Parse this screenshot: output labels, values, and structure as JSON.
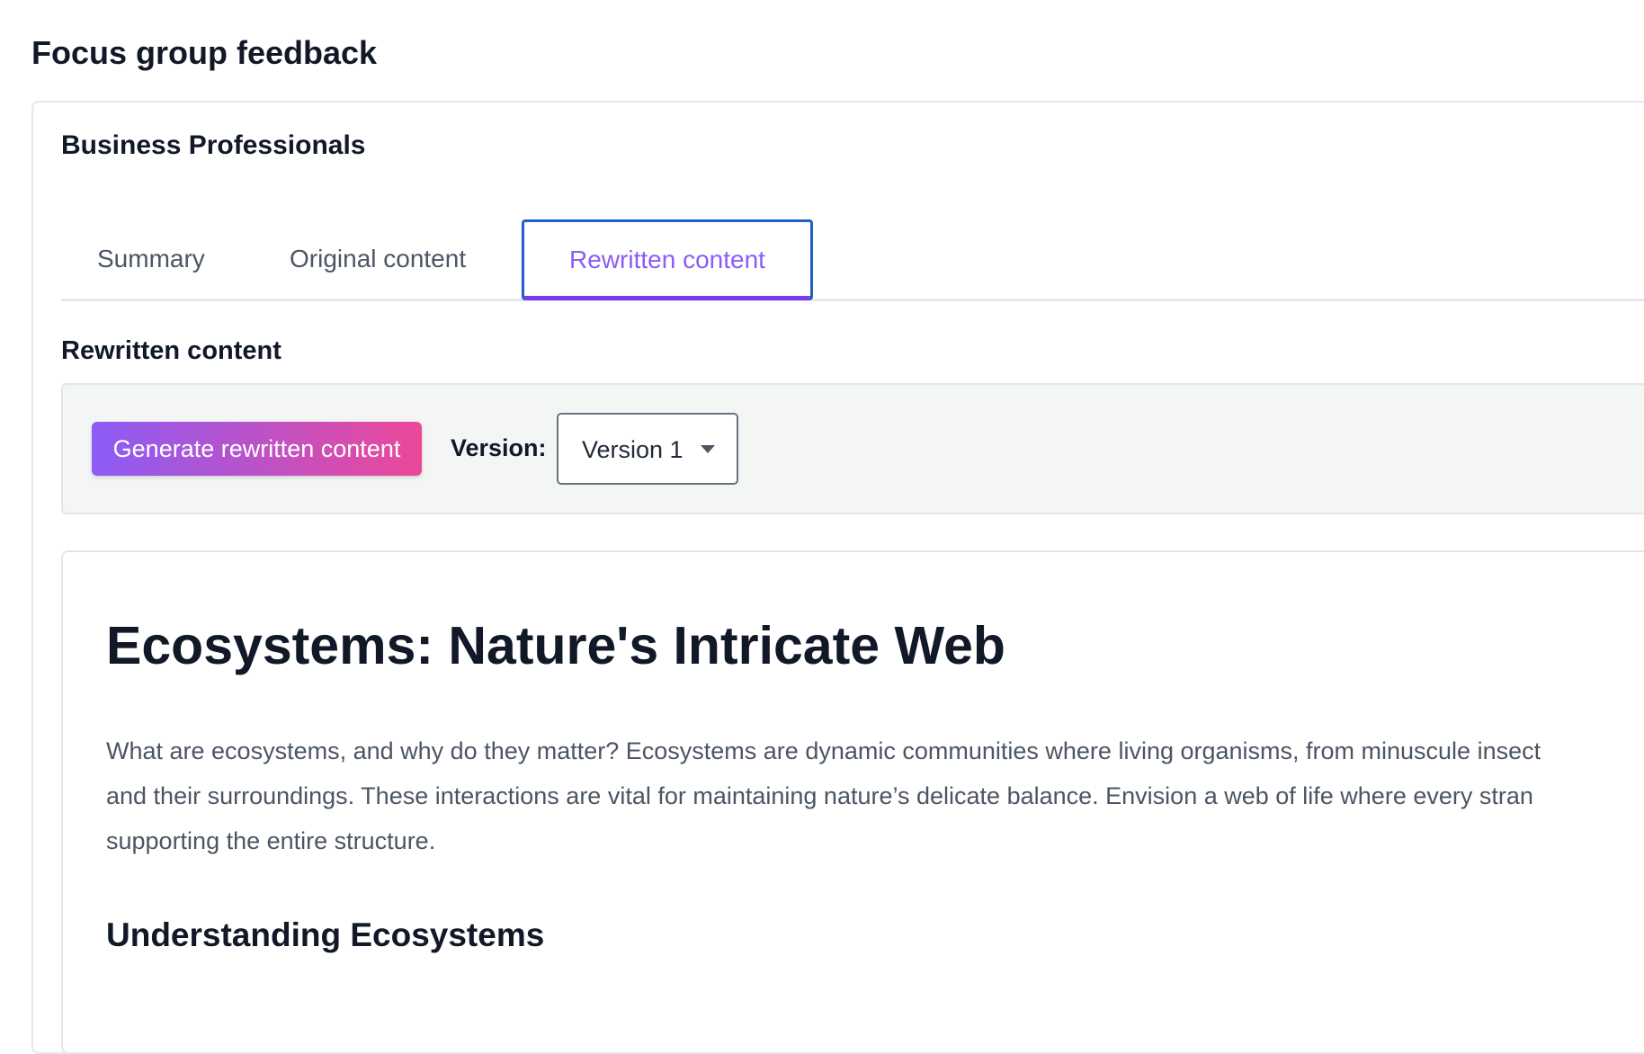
{
  "page": {
    "title": "Focus group feedback"
  },
  "group": {
    "title": "Business Professionals"
  },
  "tabs": [
    {
      "label": "Summary",
      "active": false
    },
    {
      "label": "Original content",
      "active": false
    },
    {
      "label": "Rewritten content",
      "active": true
    }
  ],
  "section": {
    "label": "Rewritten content"
  },
  "toolbar": {
    "generate_label": "Generate rewritten content",
    "version_label": "Version:",
    "version_selected": "Version 1",
    "caret_icon": "chevron-down-icon"
  },
  "article": {
    "title": "Ecosystems: Nature's Intricate Web",
    "paragraph_lines": [
      "What are ecosystems, and why do they matter? Ecosystems are dynamic communities where living organisms, from minuscule insect",
      "and their surroundings. These interactions are vital for maintaining nature’s delicate balance. Envision a web of life where every stran",
      "supporting the entire structure."
    ],
    "subheading": "Understanding Ecosystems"
  },
  "colors": {
    "accent_purple": "#8b5cf6",
    "accent_pink": "#ec4899",
    "focus_blue": "#1e5fc9",
    "text_dark": "#111827",
    "text_muted": "#4b5563"
  }
}
